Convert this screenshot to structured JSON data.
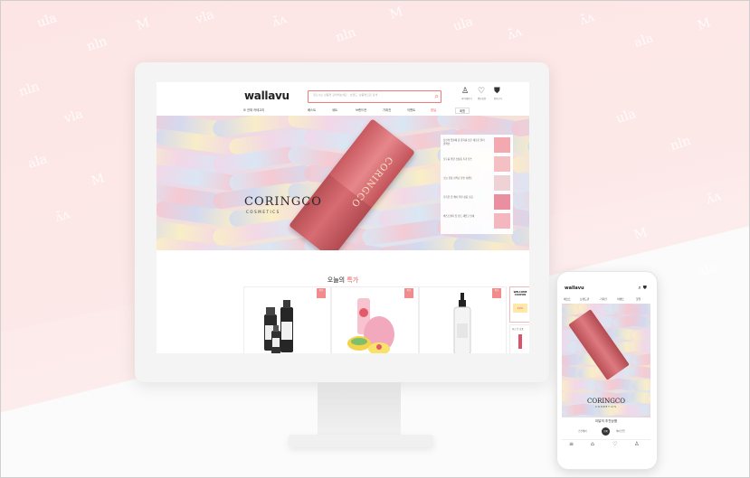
{
  "background": {
    "doodles": [
      "ula",
      "nln",
      "M",
      "vla",
      "ʌ̃ʌ",
      "nln",
      "M",
      "ula",
      "ʌ̃ʌ",
      "ʌ̃ʌ",
      "ala",
      "M",
      "nln",
      "vla",
      "ala",
      "M",
      "ʌ̃ʌ",
      "ula",
      "nln",
      "ʌ̃ʌ",
      "M",
      "ala"
    ]
  },
  "desktop": {
    "logo": "wallavu",
    "search_placeholder": "찾으시는 상품을 검색해보세요 · 브랜드, 상품명으로 검색",
    "header_icons": [
      {
        "icon": "user-icon",
        "glyph": "♙",
        "label": "마이페이지"
      },
      {
        "icon": "heart-icon",
        "glyph": "♡",
        "label": "찜한상품"
      },
      {
        "icon": "bag-icon",
        "glyph": "⛊",
        "label": "장바구니"
      }
    ],
    "category_button": "☰ 전체 카테고리",
    "nav_items": [
      "베스트",
      "세트",
      "브랜드관",
      "기획전",
      "이벤트",
      "핫딜"
    ],
    "nav_event": "회원",
    "hero": {
      "brand": "CORINGCO",
      "brand_sub": "COSMETICS",
      "product_label": "CORINGCO",
      "side_items": [
        "당신의 입술에 봄 향기를 담은 새로운 컬러 컬렉션",
        "모두를 위한 신상품 특가 찬스",
        "오늘 한정 선착순 할인 이벤트",
        "촉촉한 립 케어 추천 상품 모음",
        "베스트셀러 립 틴트 재입고 안내"
      ]
    },
    "section_title_prefix": "오늘의 ",
    "section_title_hot": "특가",
    "cards": [
      {
        "badge": "특가"
      },
      {
        "badge": "특가"
      },
      {
        "badge": "특가"
      }
    ],
    "coupon_title": "WELCOME COUPON",
    "coupon_value": "10%",
    "side_label": "최근 본 상품"
  },
  "mobile": {
    "logo": "wallavu",
    "tabs": [
      "베스트",
      "브랜드관",
      "기획전",
      "이벤트",
      "핫딜"
    ],
    "brand": "CORINGCO",
    "brand_sub": "COSMETICS",
    "section_title": "이달의 추천상품",
    "filters": [
      "스킨케어",
      "메이크업"
    ],
    "filter_button": "전체",
    "bottom_bar": [
      {
        "icon": "menu-icon",
        "glyph": "≡"
      },
      {
        "icon": "home-icon",
        "glyph": "⌂"
      },
      {
        "icon": "heart-icon",
        "glyph": "♡"
      },
      {
        "icon": "user-icon",
        "glyph": "♙"
      }
    ]
  }
}
